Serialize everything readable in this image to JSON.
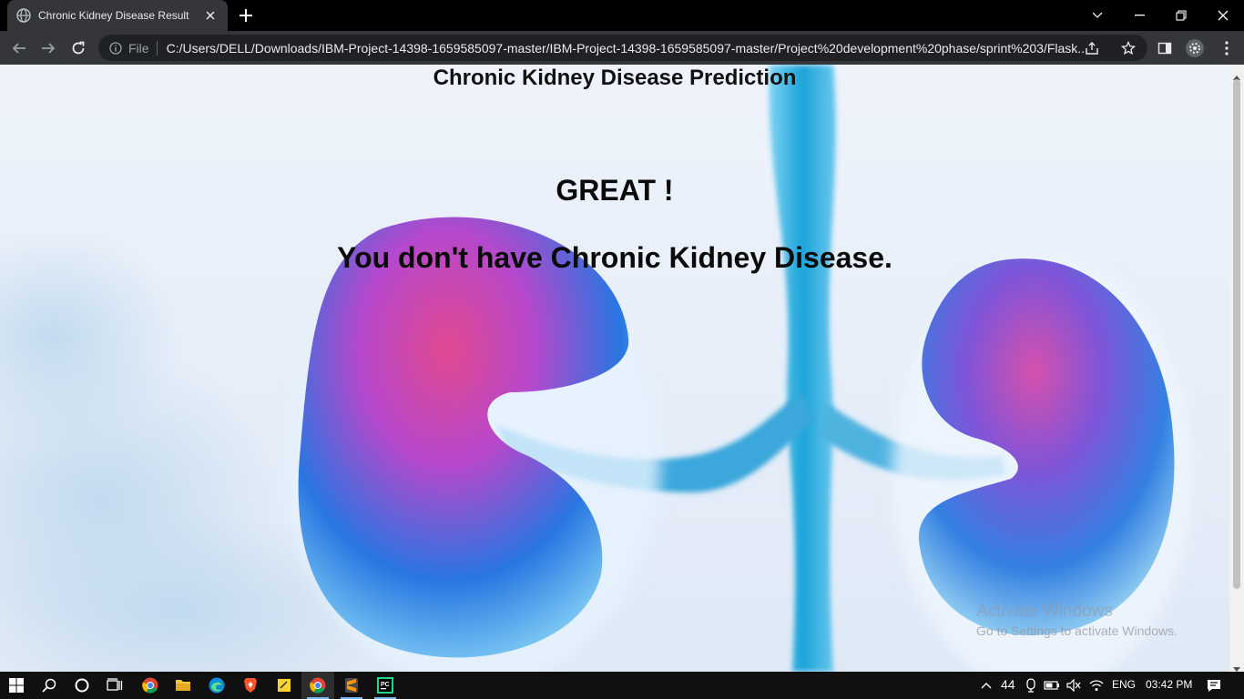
{
  "browser": {
    "tab_title": "Chronic Kidney Disease Result",
    "scheme_label": "File",
    "url": "C:/Users/DELL/Downloads/IBM-Project-14398-1659585097-master/IBM-Project-14398-1659585097-master/Project%20development%20phase/sprint%203/Flask..."
  },
  "page": {
    "heading": "Chronic Kidney Disease Prediction",
    "result_title": "GREAT !",
    "result_message": "You don't have Chronic Kidney Disease."
  },
  "watermark": {
    "line1": "Activate Windows",
    "line2": "Go to Settings to activate Windows."
  },
  "taskbar": {
    "weather_temp": "44",
    "language": "ENG",
    "time": "03:42 PM"
  },
  "colors": {
    "kidney_pink": "#e0408a",
    "kidney_blue": "#1f6fe0",
    "ureter_cyan": "#1aa3d8"
  }
}
